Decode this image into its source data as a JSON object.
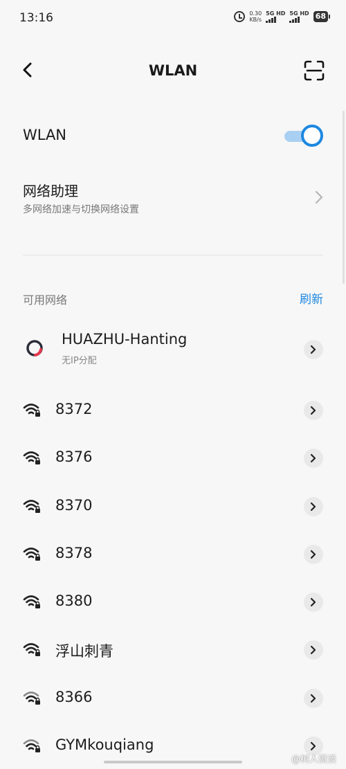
{
  "status_bar": {
    "time": "13:16",
    "speed_value": "0.30",
    "speed_unit": "KB/s",
    "signal_1_label": "5G HD",
    "signal_2_label": "5G HD",
    "battery": "68",
    "icons": [
      "alarm-icon",
      "signal-icon",
      "signal-icon",
      "battery-icon"
    ]
  },
  "header": {
    "title": "WLAN",
    "back_icon": "back-arrow-icon",
    "scan_icon": "scan-icon"
  },
  "wlan_toggle": {
    "label": "WLAN",
    "state": "on",
    "accent_color": "#1d88e0"
  },
  "assistant": {
    "title": "网络助理",
    "subtitle": "多网络加速与切换网络设置"
  },
  "available": {
    "section_label": "可用网络",
    "refresh_label": "刷新"
  },
  "networks": [
    {
      "name": "HUAZHU-Hanting",
      "status": "无IP分配",
      "icon": "connecting-icon"
    },
    {
      "name": "8372",
      "icon": "wifi-lock-icon"
    },
    {
      "name": "8376",
      "icon": "wifi-lock-icon"
    },
    {
      "name": "8370",
      "icon": "wifi-lock-icon"
    },
    {
      "name": "8378",
      "icon": "wifi-lock-icon"
    },
    {
      "name": "8380",
      "icon": "wifi-lock-icon"
    },
    {
      "name": "浮山刺青",
      "icon": "wifi-lock-icon"
    },
    {
      "name": "8366",
      "icon": "wifi-lock-icon"
    },
    {
      "name": "GYMkouqiang",
      "icon": "wifi-lock-icon"
    }
  ],
  "watermark": "@树人侃谈"
}
